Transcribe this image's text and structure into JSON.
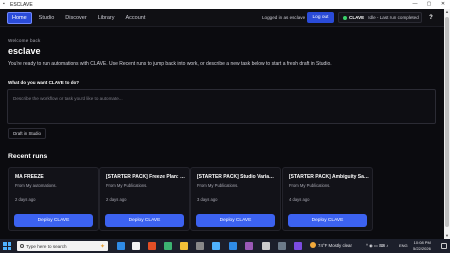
{
  "window": {
    "title": "ESCLAVE",
    "controls": [
      "—",
      "▢",
      "✕"
    ]
  },
  "nav": {
    "items": [
      {
        "label": "Home",
        "active": true
      },
      {
        "label": "Studio",
        "active": false
      },
      {
        "label": "Discover",
        "active": false
      },
      {
        "label": "Library",
        "active": false
      },
      {
        "label": "Account",
        "active": false
      }
    ]
  },
  "header": {
    "login_text": "Logged in as esclave",
    "logout_label": "Log out",
    "status_name": "CLAVE",
    "status_text": "Idle - Last run completed",
    "help_label": "?"
  },
  "main": {
    "welcome": "Welcome back",
    "title": "esclave",
    "description": "You're ready to run automations with CLAVE. Use Recent runs to jump back into work, or describe a new task below to start a fresh draft in Studio.",
    "prompt_label": "What do you want CLAVE to do?",
    "prompt_placeholder": "Describe the workflow or task you'd like to automate...",
    "draft_button": "Draft in Studio",
    "recent_title": "Recent runs"
  },
  "recent_runs": [
    {
      "title": "MA FREEZE",
      "source": "From My automations.",
      "age": "2 days ago",
      "button": "Deploy CLAVE"
    },
    {
      "title": "[STARTER PACK] Freeze Plan: S...",
      "source": "From My Publications.",
      "age": "2 days ago",
      "button": "Deploy CLAVE"
    },
    {
      "title": "[STARTER PACK] Studio Variabl...",
      "source": "From My Publications.",
      "age": "3 days ago",
      "button": "Deploy CLAVE"
    },
    {
      "title": "[STARTER PACK] Ambiguity Saf...",
      "source": "From My Publications.",
      "age": "4 days ago",
      "button": "Deploy CLAVE"
    }
  ],
  "taskbar": {
    "search_placeholder": "Type here to search",
    "weather": "74°F  Mostly clear",
    "tray": "^  ◉  ▭  ⌨  ♪",
    "lang": "ENG",
    "time": "10:08 PM",
    "date": "5/22/2026",
    "icon_colors": [
      "#2f8be6",
      "#f2f2f2",
      "#e34f26",
      "#3cb371",
      "#f2c037",
      "#888888",
      "#4fb3ff",
      "#2f8be6",
      "#9b59b6",
      "#cccccc",
      "#6c7a89",
      "#7b4ce0"
    ]
  },
  "colors": {
    "accent": "#2a4bd8",
    "deploy": "#3c62f0",
    "status_ok": "#39d26a",
    "background": "#0b0b0f"
  }
}
